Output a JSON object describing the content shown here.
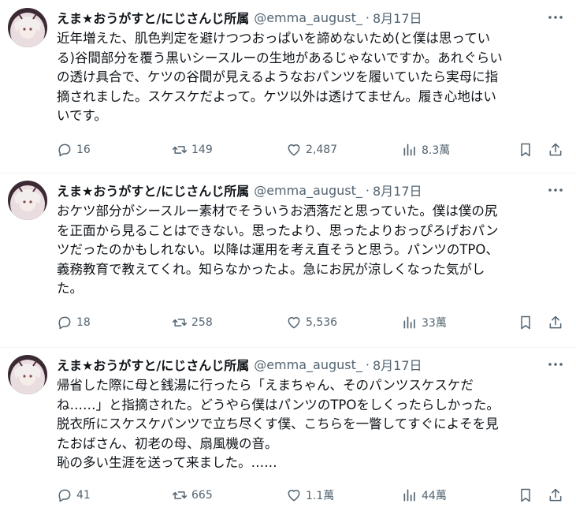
{
  "colors": {
    "text": "#0f1419",
    "secondary": "#536471",
    "divider": "#eff3f4",
    "background": "#ffffff"
  },
  "tweets": [
    {
      "author_name": "えま★おうがすと/にじさんじ所属",
      "handle": "@emma_august_",
      "separator": "·",
      "date": "8月17日",
      "text": "近年増えた、肌色判定を避けつつおっぱいを諦めないため(と僕は思ってい\nる)谷間部分を覆う黒いシースルーの生地があるじゃないですか。あれぐらい\nの透け具合で、ケツの谷間が見えるようなおパンツを履いていたら実母に指\n摘されました。スケスケだよって。ケツ以外は透けてません。履き心地はい\nいです。",
      "replies": "16",
      "retweets": "149",
      "likes": "2,487",
      "views": "8.3萬"
    },
    {
      "author_name": "えま★おうがすと/にじさんじ所属",
      "handle": "@emma_august_",
      "separator": "·",
      "date": "8月17日",
      "text": "おケツ部分がシースルー素材でそういうお洒落だと思っていた。僕は僕の尻\nを正面から見ることはできない。思ったより、思ったよりおっぴろげおパン\nツだったのかもしれない。以降は運用を考え直そうと思う。パンツのTPO、\n義務教育で教えてくれ。知らなかったよ。急にお尻が涼しくなった気がし\nた。",
      "replies": "18",
      "retweets": "258",
      "likes": "5,536",
      "views": "33萬"
    },
    {
      "author_name": "えま★おうがすと/にじさんじ所属",
      "handle": "@emma_august_",
      "separator": "·",
      "date": "8月17日",
      "text": "帰省した際に母と銭湯に行ったら「えまちゃん、そのパンツスケスケだ\nね……」と指摘された。どうやら僕はパンツのTPOをしくったらしかった。\n脱衣所にスケスケパンツで立ち尽くす僕、こちらを一瞥してすぐによそを見\nたおばさん、初老の母、扇風機の音。\n恥の多い生涯を送って来ました。……",
      "replies": "41",
      "retweets": "665",
      "likes": "1.1萬",
      "views": "44萬"
    }
  ]
}
